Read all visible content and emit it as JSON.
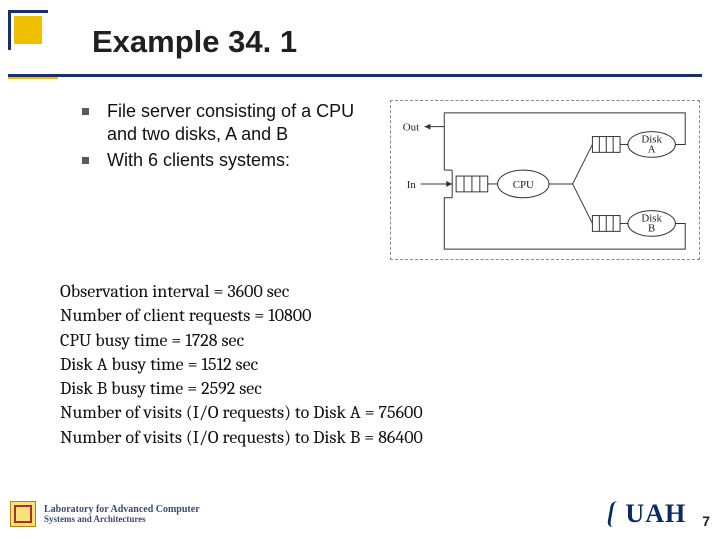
{
  "title": "Example 34. 1",
  "bullets": [
    "File server consisting of a CPU and two disks, A and B",
    "With 6 clients systems:"
  ],
  "diagram": {
    "out_label": "Out",
    "in_label": "In",
    "cpu_label": "CPU",
    "disk_a_label": "Disk A",
    "disk_b_label": "Disk B"
  },
  "observations": [
    "Observation interval = 3600 sec",
    "Number of client requests = 10800",
    "CPU busy time = 1728 sec",
    "Disk A busy time = 1512 sec",
    "Disk B busy time = 2592 sec",
    "Number of visits (I/O requests) to Disk A = 75600",
    "Number of visits (I/O requests) to Disk B = 86400"
  ],
  "footer": {
    "lab_line1": "Laboratory for Advanced Computer",
    "lab_line2": "Systems and Architectures",
    "university": "UAH",
    "page": "7"
  },
  "chart_data": {
    "type": "table",
    "title": "Example 34.1 — measured values",
    "rows": [
      {
        "label": "Observation interval",
        "value": 3600,
        "unit": "sec"
      },
      {
        "label": "Number of client requests",
        "value": 10800,
        "unit": ""
      },
      {
        "label": "CPU busy time",
        "value": 1728,
        "unit": "sec"
      },
      {
        "label": "Disk A busy time",
        "value": 1512,
        "unit": "sec"
      },
      {
        "label": "Disk B busy time",
        "value": 2592,
        "unit": "sec"
      },
      {
        "label": "Number of visits (I/O requests) to Disk A",
        "value": 75600,
        "unit": ""
      },
      {
        "label": "Number of visits (I/O requests) to Disk B",
        "value": 86400,
        "unit": ""
      }
    ]
  }
}
